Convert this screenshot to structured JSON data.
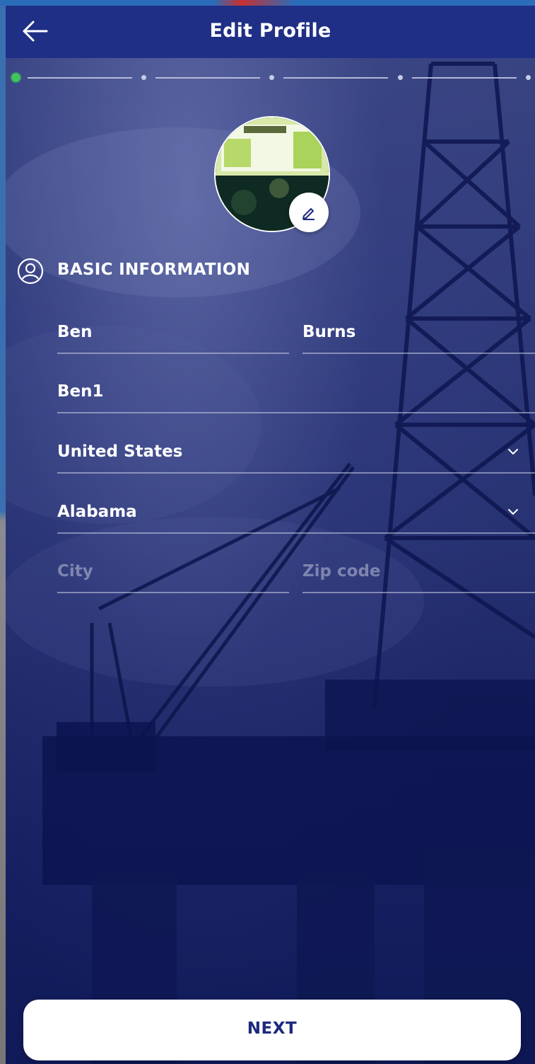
{
  "header": {
    "title": "Edit Profile"
  },
  "stepper": {
    "current_step": 1,
    "total_steps": 5
  },
  "section": {
    "title": "BASIC INFORMATION"
  },
  "form": {
    "first_name": {
      "value": "Ben"
    },
    "last_name": {
      "value": "Burns"
    },
    "username": {
      "value": "Ben1"
    },
    "country": {
      "value": "United States"
    },
    "state": {
      "value": "Alabama"
    },
    "city": {
      "value": "",
      "placeholder": "City"
    },
    "zip": {
      "value": "",
      "placeholder": "Zip code"
    }
  },
  "actions": {
    "next_label": "NEXT"
  },
  "colors": {
    "header_bg": "#1f2f86",
    "overlay": "#1b2566",
    "active_step": "#3fc55c",
    "button_text": "#1d2a7e"
  },
  "icons": [
    "arrow-left-icon",
    "pencil-icon",
    "user-circle-icon",
    "chevron-down-icon"
  ]
}
